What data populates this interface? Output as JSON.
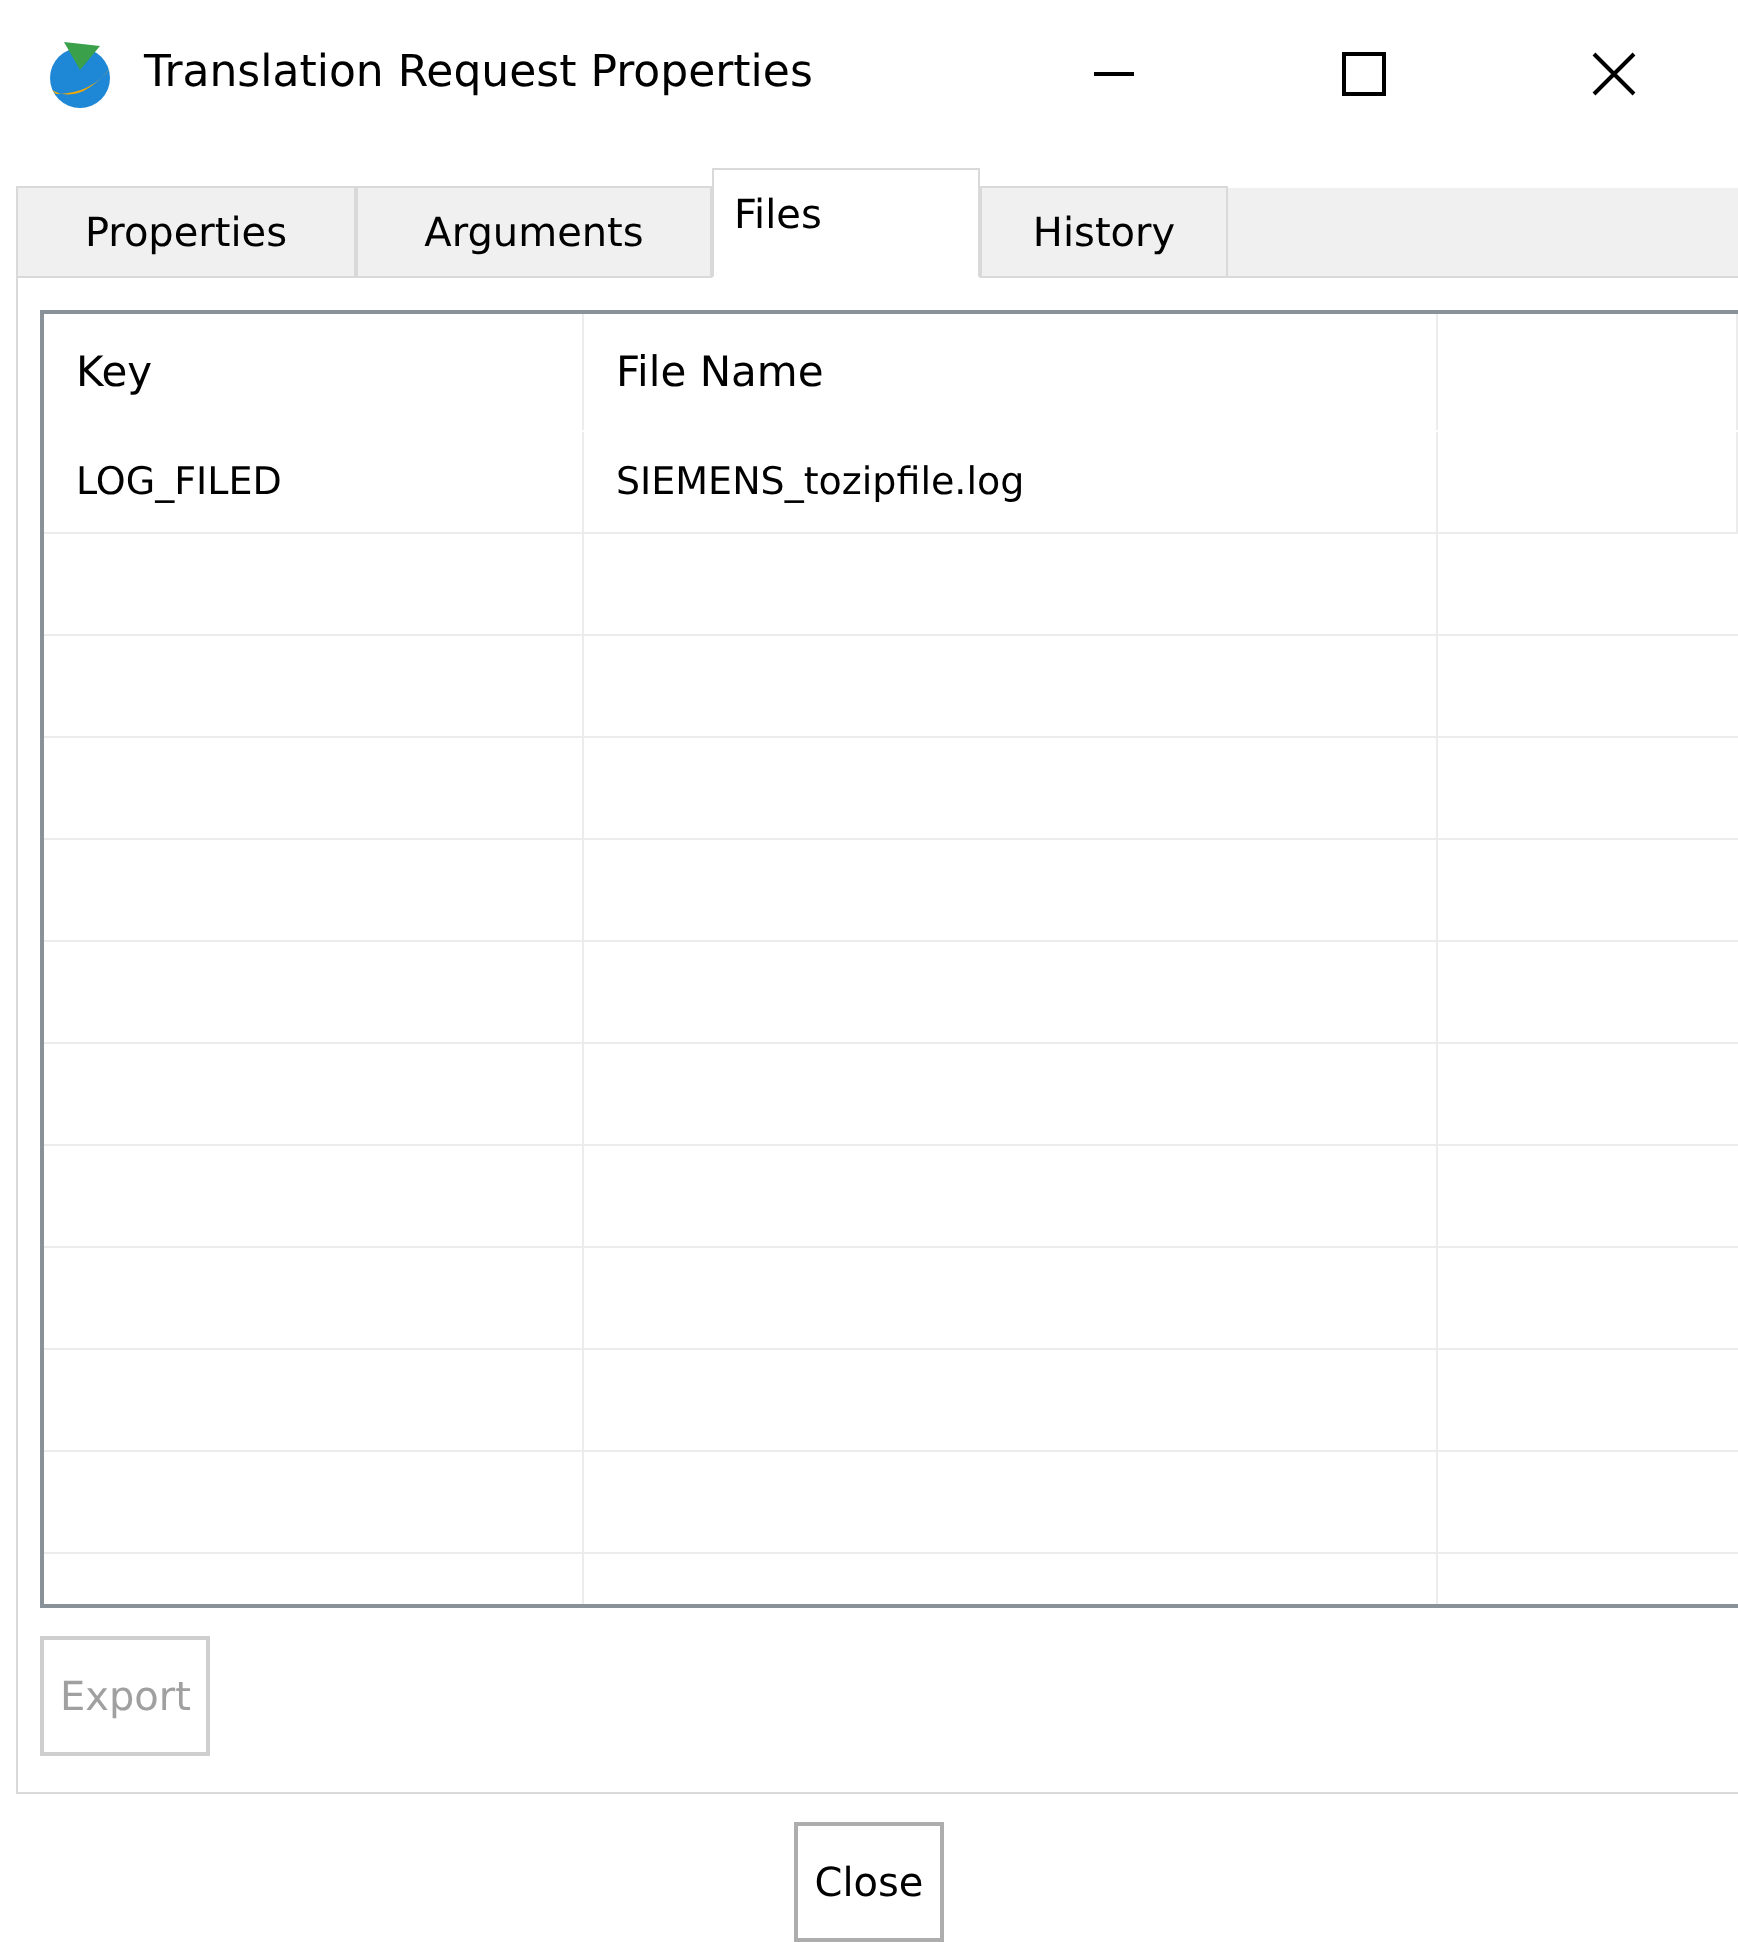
{
  "window": {
    "title": "Translation Request Properties"
  },
  "tabs": [
    {
      "label": "Properties",
      "selected": false
    },
    {
      "label": "Arguments",
      "selected": false
    },
    {
      "label": "Files",
      "selected": true
    },
    {
      "label": "History",
      "selected": false
    }
  ],
  "table": {
    "columns": [
      "Key",
      "File Name"
    ],
    "rows": [
      {
        "key": "LOG_FILED",
        "file_name": "SIEMENS_tozipfile.log"
      }
    ]
  },
  "buttons": [
    {
      "label": "Export",
      "disabled": true
    },
    {
      "label": "Close",
      "disabled": false
    }
  ]
}
